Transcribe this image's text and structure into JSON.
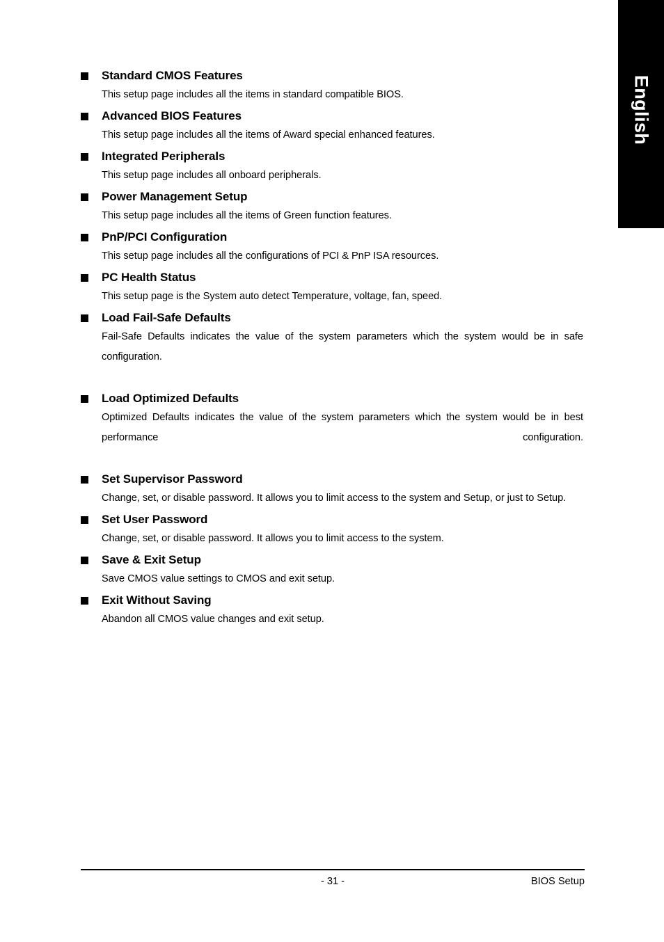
{
  "language_tab": {
    "label": "English"
  },
  "sections": [
    {
      "title": "Standard CMOS Features",
      "body": "This setup page includes all the items in standard compatible BIOS.",
      "justified": false
    },
    {
      "title": "Advanced BIOS Features",
      "body": "This setup page includes all the items of Award special enhanced features.",
      "justified": false
    },
    {
      "title": "Integrated Peripherals",
      "body": "This setup page includes all onboard peripherals.",
      "justified": false
    },
    {
      "title": "Power Management Setup",
      "body": "This setup page includes all the items of Green function features.",
      "justified": false
    },
    {
      "title": "PnP/PCI Configuration",
      "body": "This setup page includes all the configurations of PCI & PnP ISA resources.",
      "justified": false
    },
    {
      "title": "PC Health Status",
      "body": "This setup page is the System auto detect Temperature, voltage, fan, speed.",
      "justified": false
    },
    {
      "title": "Load Fail-Safe Defaults",
      "body": "Fail-Safe Defaults indicates the value of the system parameters which the system would be in safe configuration.",
      "justified": true
    },
    {
      "title": "Load Optimized Defaults",
      "body": "Optimized Defaults indicates the value of the system parameters which the system would be in best performance configuration.",
      "justified": true
    },
    {
      "title": "Set Supervisor Password",
      "body": "Change, set, or disable password. It allows you to limit access to the system and Setup, or just to Setup.",
      "justified": false
    },
    {
      "title": "Set User Password",
      "body": "Change, set, or disable password. It allows you to limit access to the system.",
      "justified": false
    },
    {
      "title": "Save & Exit Setup",
      "body": "Save CMOS value settings to CMOS and exit setup.",
      "justified": false
    },
    {
      "title": "Exit Without Saving",
      "body": "Abandon all CMOS value changes and exit setup.",
      "justified": false
    }
  ],
  "footer": {
    "page_number": "- 31 -",
    "section_name": "BIOS Setup"
  }
}
